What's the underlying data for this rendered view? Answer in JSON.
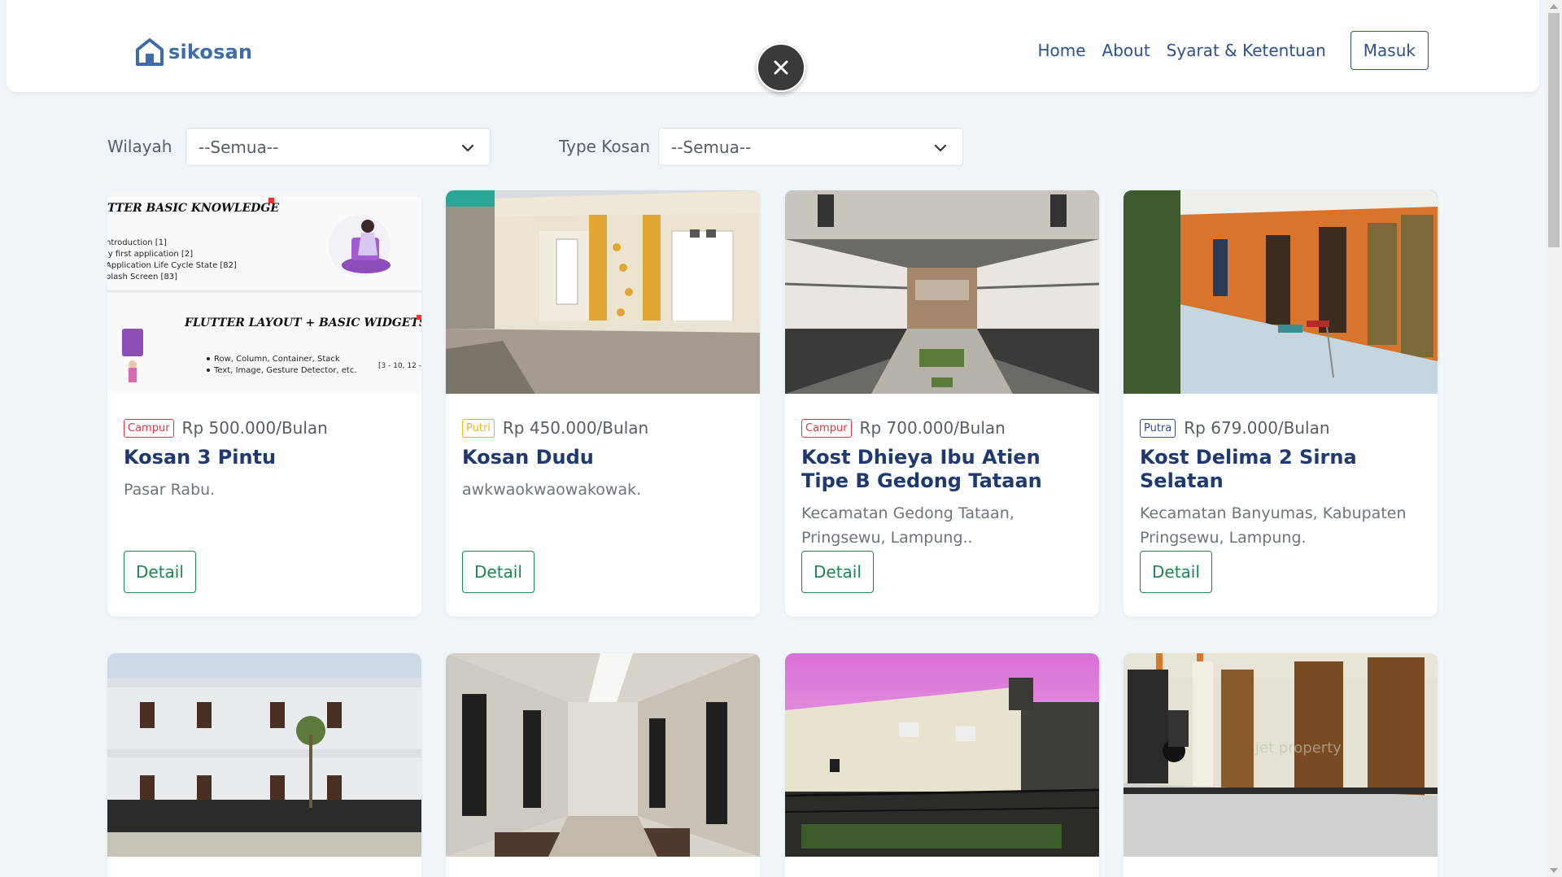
{
  "brand": {
    "name": "sikosan",
    "icon": "house-icon",
    "color": "#3f6dab"
  },
  "nav": {
    "links": [
      "Home",
      "About",
      "Syarat & Ketentuan"
    ],
    "login_label": "Masuk"
  },
  "overlay": {
    "close_icon": "close-icon"
  },
  "filters": {
    "region_label": "Wilayah",
    "region_value": "--Semua--",
    "type_label": "Type Kosan",
    "type_value": "--Semua--"
  },
  "cards": [
    {
      "badge": "Campur",
      "price": "Rp 500.000/Bulan",
      "title": "Kosan 3 Pintu",
      "address": "Pasar Rabu.",
      "detail_label": "Detail"
    },
    {
      "badge": "Putri",
      "price": "Rp 450.000/Bulan",
      "title": "Kosan Dudu",
      "address": "awkwaokwaowakowak.",
      "detail_label": "Detail"
    },
    {
      "badge": "Campur",
      "price": "Rp 700.000/Bulan",
      "title": "Kost Dhieya Ibu Atien Tipe B Gedong Tataan",
      "address": "Kecamatan Gedong Tataan, Pringsewu, Lampung..",
      "detail_label": "Detail"
    },
    {
      "badge": "Putra",
      "price": "Rp 679.000/Bulan",
      "title": "Kost Delima 2 Sirna Selatan",
      "address": "Kecamatan Banyumas, Kabupaten Pringsewu, Lampung.",
      "detail_label": "Detail"
    }
  ],
  "thumb_text": {
    "heading1": "TTER BASIC KNOWLEDGE",
    "items1": [
      "ntroduction [1]",
      "ly first application [2]",
      "Application Life Cycle State [82]",
      "plash Screen [83]"
    ],
    "heading2": "FLUTTER LAYOUT + BASIC WIDGETS",
    "items2": [
      "Row, Column, Container, Stack",
      "Text, Image, Gesture Detector, etc."
    ],
    "range": "[3 - 10, 12 -"
  },
  "watermark": "jet property",
  "colors": {
    "accent": "#2c5190",
    "detail": "#198754",
    "campur": "#dc3545",
    "putri": "#e8b61c",
    "putra": "#2c5190",
    "background": "#f0f5fa"
  }
}
